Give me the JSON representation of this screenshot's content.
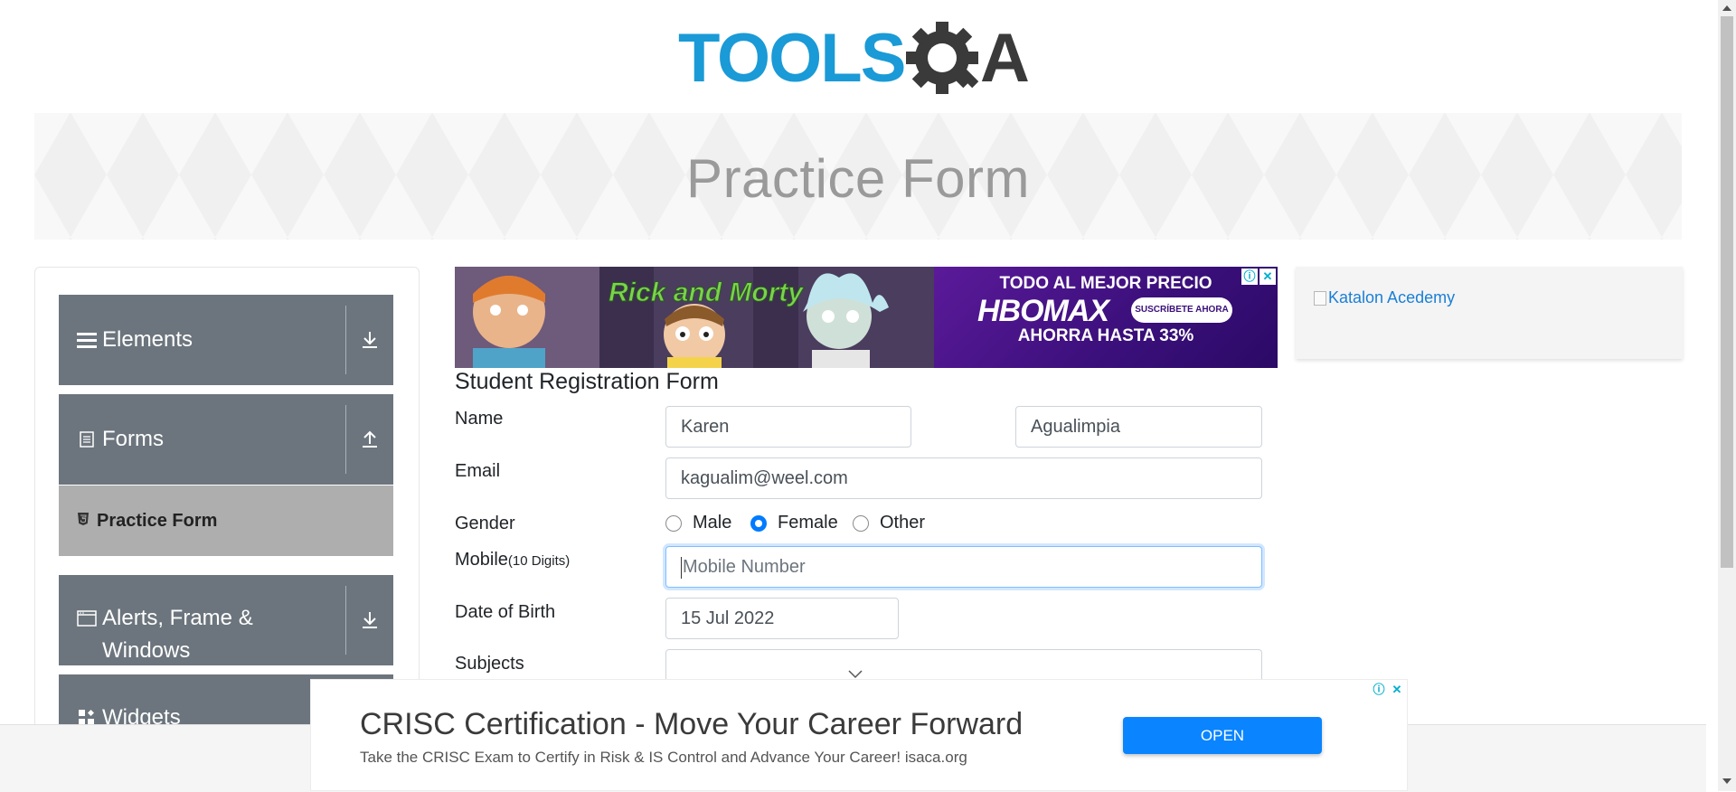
{
  "header": {
    "logo_text_left": "TOOLS",
    "logo_text_right": "QA",
    "page_title": "Practice Form"
  },
  "sidebar": {
    "groups": [
      {
        "label": "Elements",
        "icon": "hamburger-icon",
        "arrow": "download-icon"
      },
      {
        "label": "Forms",
        "icon": "document-icon",
        "arrow": "upload-icon"
      },
      {
        "label": "Alerts, Frame &",
        "label2": "Windows",
        "icon": "window-icon",
        "arrow": "download-icon"
      },
      {
        "label": "Widgets",
        "icon": "widgets-icon"
      }
    ],
    "active_item": {
      "label": "Practice Form",
      "icon": "html5-icon"
    }
  },
  "ads": {
    "top": {
      "left_text": "Rick and Morty",
      "line1": "TODO AL MEJOR PRECIO",
      "brand": "HBOMAX",
      "cta": "SUSCRÍBETE AHORA",
      "line3": "AHORRA HASTA 33%"
    },
    "side": {
      "link_text": "Katalon Acedemy"
    },
    "bottom": {
      "title": "CRISC Certification - Move Your Career Forward",
      "text": "Take the CRISC Exam to Certify in Risk & IS Control and Advance Your Career! isaca.org",
      "button": "OPEN"
    }
  },
  "form": {
    "title": "Student Registration Form",
    "name_label": "Name",
    "first_name": "Karen",
    "last_name": "Agualimpia",
    "email_label": "Email",
    "email": "kagualim@weel.com",
    "gender_label": "Gender",
    "gender_options": [
      "Male",
      "Female",
      "Other"
    ],
    "gender_selected": "Female",
    "mobile_label": "Mobile",
    "mobile_hint": "(10 Digits)",
    "mobile_placeholder": "Mobile Number",
    "dob_label": "Date of Birth",
    "dob": "15 Jul 2022",
    "subjects_label": "Subjects"
  },
  "colors": {
    "sidebar_bg": "#6c757d",
    "active_bg": "#aeaeae",
    "primary": "#007bff",
    "logo_blue": "#1a9ad6",
    "logo_dark": "#3a3a3a"
  }
}
